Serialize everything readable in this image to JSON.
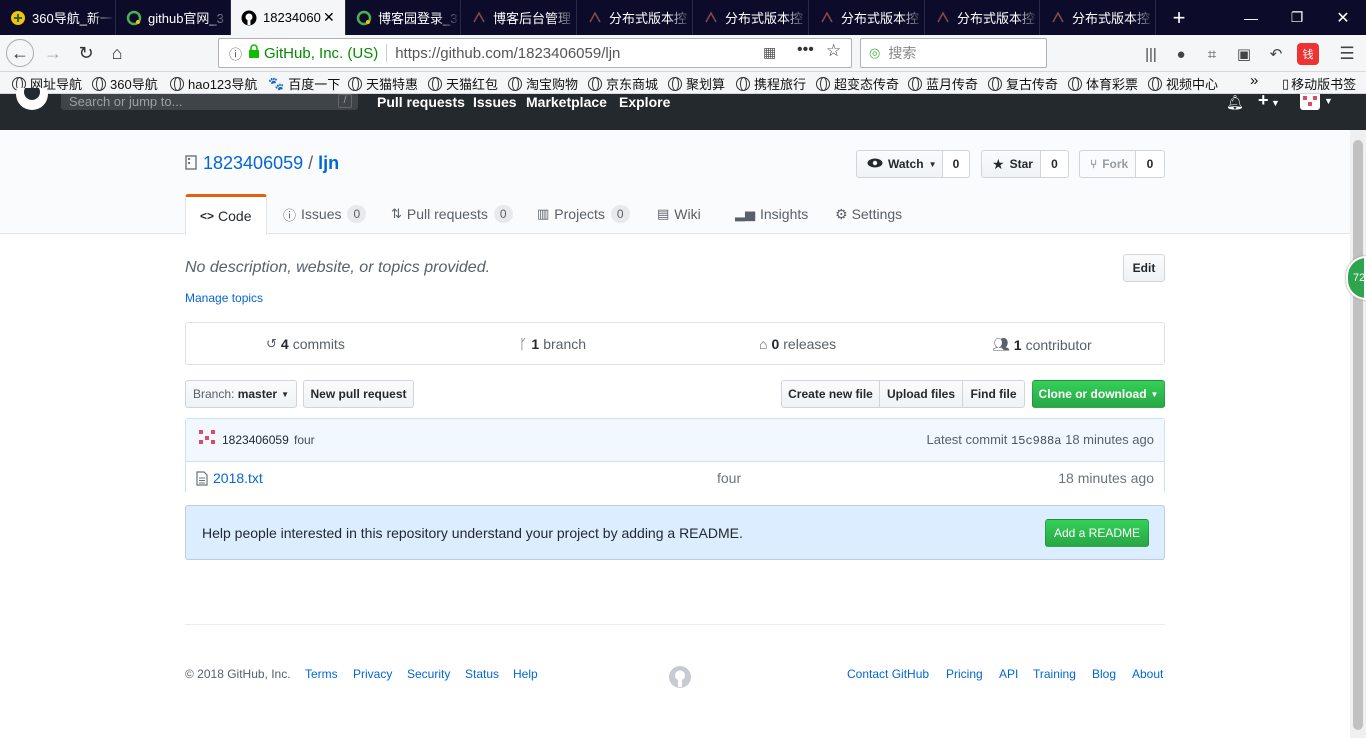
{
  "browser": {
    "tabs": [
      {
        "label": "360导航_新一",
        "icon": "360-logo-icon"
      },
      {
        "label": "github官网_3",
        "icon": "360-search-icon"
      },
      {
        "label": "18234060",
        "icon": "github-icon"
      },
      {
        "label": "博客园登录_3",
        "icon": "360-search-icon"
      },
      {
        "label": "博客后台管理",
        "icon": "page-icon"
      },
      {
        "label": "分布式版本控",
        "icon": "page-icon"
      },
      {
        "label": "分布式版本控",
        "icon": "page-icon"
      },
      {
        "label": "分布式版本控",
        "icon": "page-icon"
      },
      {
        "label": "分布式版本控",
        "icon": "page-icon"
      },
      {
        "label": "分布式版本控",
        "icon": "page-icon"
      }
    ],
    "new_tab": "+",
    "url_identity": "GitHub, Inc. (US)",
    "url": "https://github.com/1823406059/ljn",
    "search_placeholder": "搜索",
    "bookmarks": [
      "网址导航",
      "360导航",
      "hao123导航",
      "百度一下",
      "天猫特惠",
      "天猫红包",
      "淘宝购物",
      "京东商城",
      "聚划算",
      "携程旅行",
      "超变态传奇",
      "蓝月传奇",
      "复古传奇",
      "体育彩票",
      "视频中心"
    ],
    "bookmarks_overflow": "»",
    "mobile_bookmarks": "移动版书签"
  },
  "github": {
    "search_placeholder": "Search or jump to...",
    "search_key": "/",
    "nav": [
      "Pull requests",
      "Issues",
      "Marketplace",
      "Explore"
    ],
    "plus": "+",
    "green_badge": "72"
  },
  "repo": {
    "owner": "1823406059",
    "separator": "/",
    "name": "ljn",
    "watch_label": "Watch",
    "watch_count": "0",
    "star_label": "Star",
    "star_count": "0",
    "fork_label": "Fork",
    "fork_count": "0",
    "tabs": [
      {
        "label": "Code",
        "count": ""
      },
      {
        "label": "Issues",
        "count": "0"
      },
      {
        "label": "Pull requests",
        "count": "0"
      },
      {
        "label": "Projects",
        "count": "0"
      },
      {
        "label": "Wiki",
        "count": ""
      },
      {
        "label": "Insights",
        "count": ""
      },
      {
        "label": "Settings",
        "count": ""
      }
    ],
    "description": "No description, website, or topics provided.",
    "edit_label": "Edit",
    "manage_topics": "Manage topics",
    "summary": {
      "commits_num": "4",
      "commits_label": "commits",
      "branch_num": "1",
      "branch_label": "branch",
      "releases_num": "0",
      "releases_label": "releases",
      "contributor_num": "1",
      "contributor_label": "contributor"
    },
    "branch_prefix": "Branch:",
    "branch_name": "master",
    "new_pull_request": "New pull request",
    "create_new_file": "Create new file",
    "upload_files": "Upload files",
    "find_file": "Find file",
    "clone_or_download": "Clone or download",
    "commit": {
      "author": "1823406059",
      "message": "four",
      "latest_label": "Latest commit",
      "sha": "15c988a",
      "age": "18 minutes ago"
    },
    "files": [
      {
        "name": "2018.txt",
        "message": "four",
        "age": "18 minutes ago"
      }
    ],
    "readme_prompt": "Help people interested in this repository understand your project by adding a README.",
    "add_readme": "Add a README"
  },
  "footer": {
    "copyright": "© 2018 GitHub, Inc.",
    "left_links": [
      "Terms",
      "Privacy",
      "Security",
      "Status",
      "Help"
    ],
    "right_links": [
      "Contact GitHub",
      "Pricing",
      "API",
      "Training",
      "Blog",
      "About"
    ]
  },
  "colors": {
    "github_header": "#24292e",
    "link": "#0366d6",
    "primary_button": "#28a745",
    "tab_accent": "#e36209",
    "browser_tabbar": "#0c0c2a"
  }
}
